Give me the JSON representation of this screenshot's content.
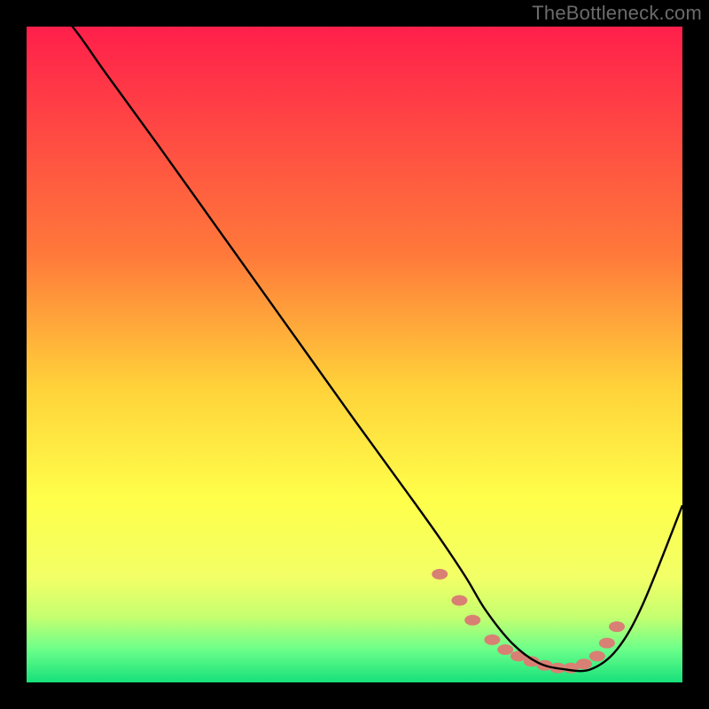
{
  "watermark": "TheBottleneck.com",
  "chart_data": {
    "type": "line",
    "title": "",
    "xlabel": "",
    "ylabel": "",
    "xlim": [
      0,
      100
    ],
    "ylim": [
      0,
      100
    ],
    "background_gradient": {
      "stops": [
        {
          "offset": 0,
          "color": "#ff1f4b"
        },
        {
          "offset": 35,
          "color": "#ff7a3a"
        },
        {
          "offset": 55,
          "color": "#ffd23a"
        },
        {
          "offset": 72,
          "color": "#ffff4a"
        },
        {
          "offset": 84,
          "color": "#f2ff66"
        },
        {
          "offset": 90,
          "color": "#c5ff70"
        },
        {
          "offset": 95,
          "color": "#6bff8a"
        },
        {
          "offset": 100,
          "color": "#16e07a"
        }
      ]
    },
    "series": [
      {
        "name": "bottleneck-curve",
        "x": [
          0,
          7,
          12,
          20,
          30,
          40,
          50,
          58,
          63,
          67,
          70,
          74,
          78,
          82,
          86,
          90,
          94,
          100
        ],
        "y": [
          108,
          100,
          93,
          82,
          68,
          54,
          40,
          29,
          22,
          16,
          11,
          6,
          3,
          2,
          2,
          5,
          12,
          27
        ]
      }
    ],
    "markers": {
      "name": "highlight-dots",
      "color": "#d98074",
      "points": [
        {
          "x": 63,
          "y": 16.5
        },
        {
          "x": 66,
          "y": 12.5
        },
        {
          "x": 68,
          "y": 9.5
        },
        {
          "x": 71,
          "y": 6.5
        },
        {
          "x": 73,
          "y": 5.0
        },
        {
          "x": 75,
          "y": 4.0
        },
        {
          "x": 77,
          "y": 3.2
        },
        {
          "x": 79,
          "y": 2.6
        },
        {
          "x": 81,
          "y": 2.2
        },
        {
          "x": 83,
          "y": 2.2
        },
        {
          "x": 85,
          "y": 2.8
        },
        {
          "x": 87,
          "y": 4.0
        },
        {
          "x": 88.5,
          "y": 6.0
        },
        {
          "x": 90,
          "y": 8.5
        }
      ]
    }
  }
}
